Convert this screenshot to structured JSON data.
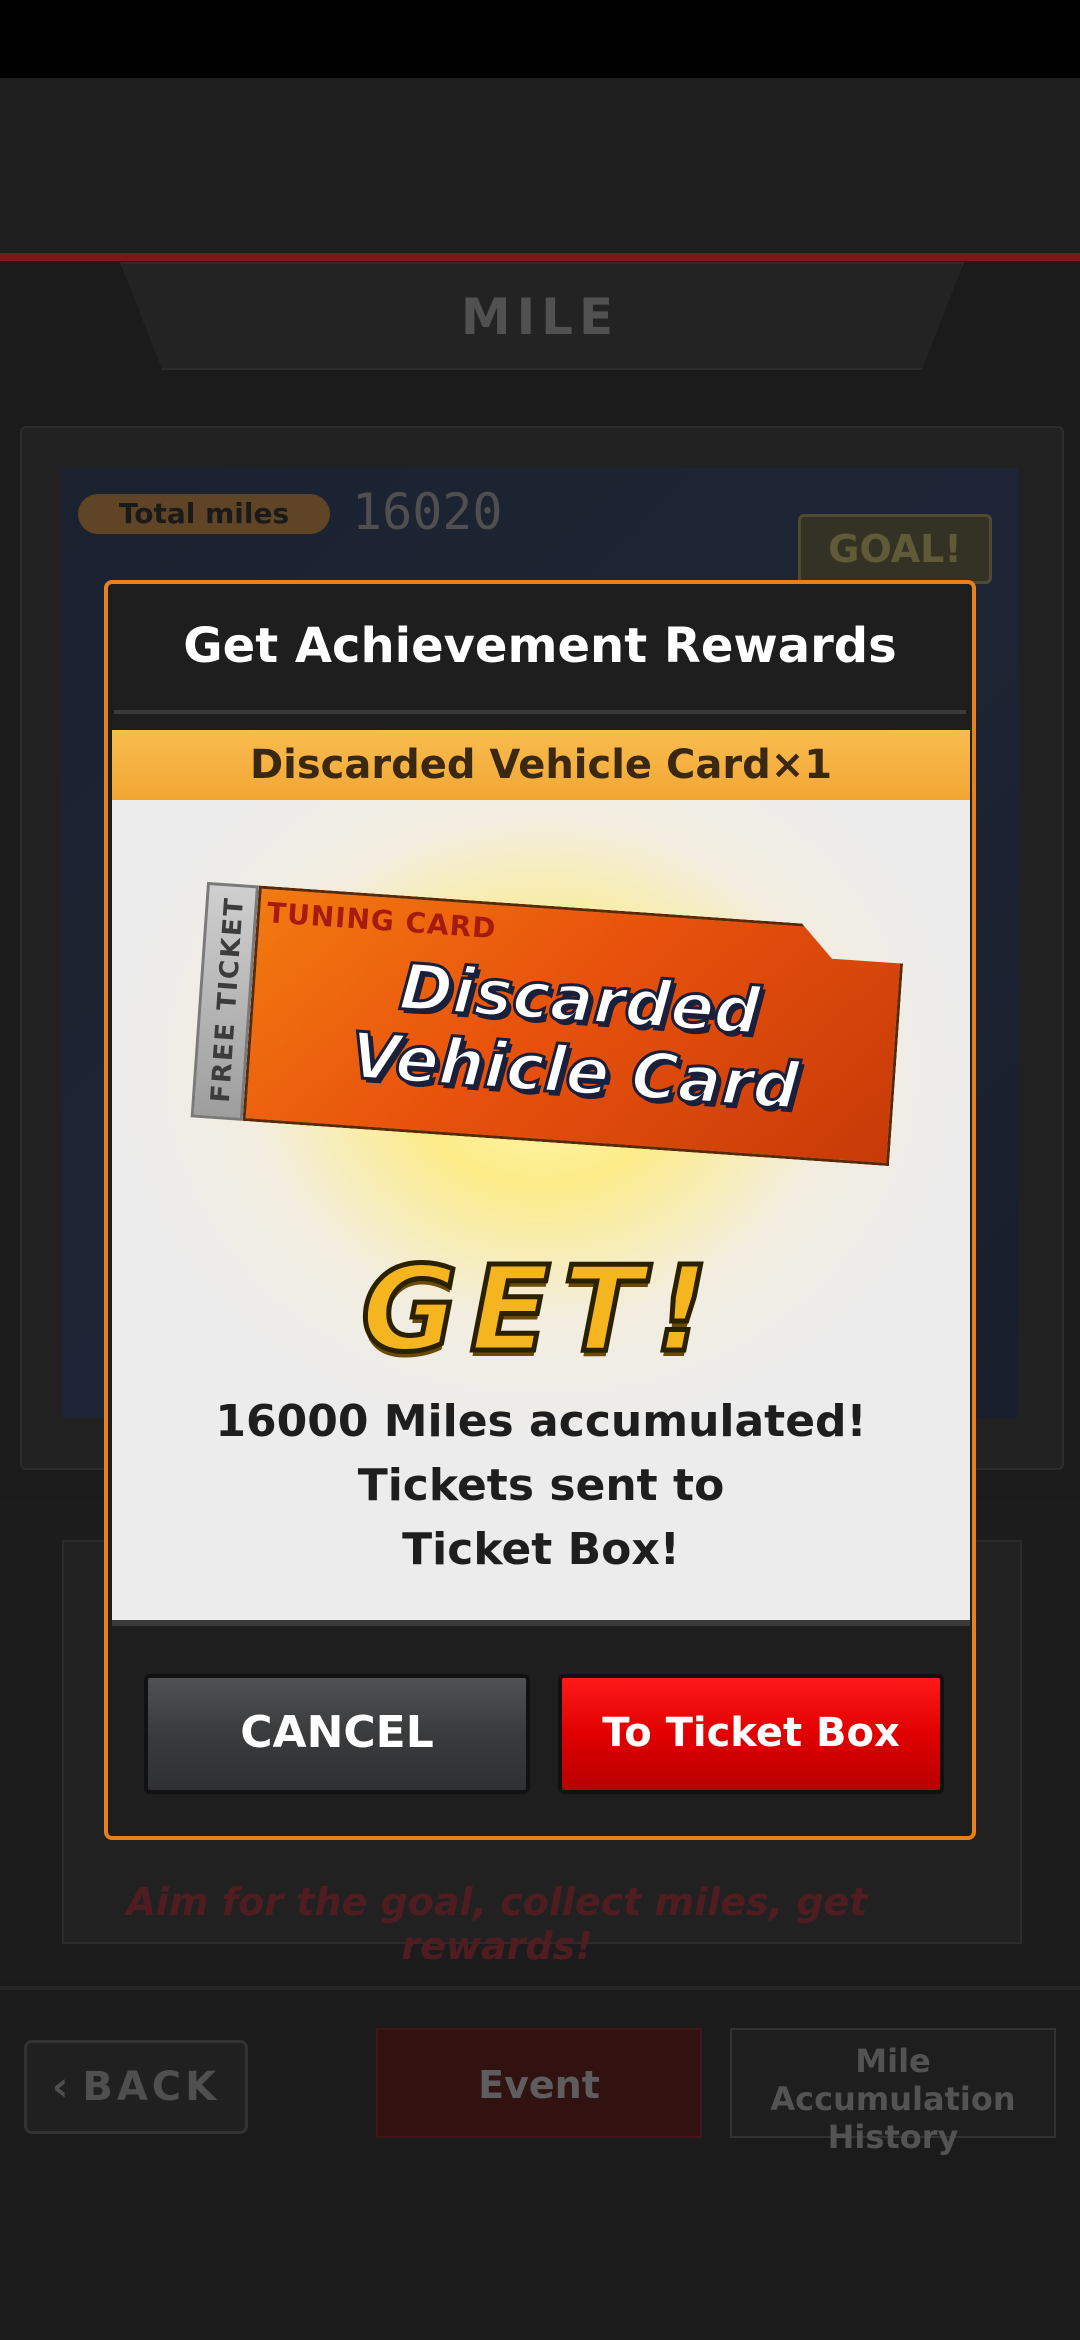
{
  "header": {
    "title": "MILE"
  },
  "miles": {
    "label": "Total miles",
    "value": "16020",
    "goal_badge": "GOAL!"
  },
  "banner_text": "Aim for the goal, collect miles, get rewards!",
  "footer": {
    "back_label": "BACK",
    "event_label": "Event",
    "history_label_1": "Mile Accumulation",
    "history_label_2": "History"
  },
  "modal": {
    "title": "Get Achievement Rewards",
    "item_label": "Discarded Vehicle Card×1",
    "card": {
      "stub_text": "FREE TICKET",
      "top_text": "TUNING CARD",
      "main_line1": "Discarded",
      "main_line2": "Vehicle Card"
    },
    "get_text": "GET!",
    "message_line1": "16000 Miles accumulated!",
    "message_line2": "Tickets sent to",
    "message_line3": "Ticket Box!",
    "cancel_label": "CANCEL",
    "ticket_box_label": "To Ticket Box"
  },
  "colors": {
    "modal_border": "#e5821f",
    "item_banner": "#f9bc4f",
    "primary_button": "#e00000",
    "get_text": "#f5b51e"
  }
}
